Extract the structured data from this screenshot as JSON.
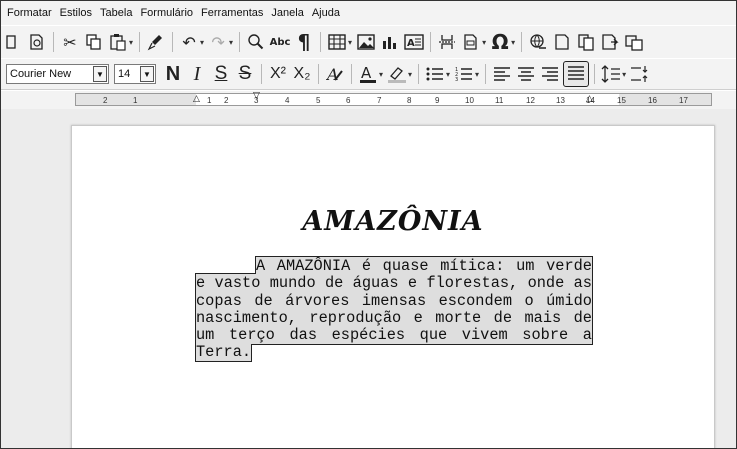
{
  "menu": {
    "items": [
      "Formatar",
      "Estilos",
      "Tabela",
      "Formulário",
      "Ferramentas",
      "Janela",
      "Ajuda"
    ]
  },
  "toolbar2": {
    "font_name": "Courier New",
    "font_size": "14",
    "bold_label": "N",
    "italic_label": "I",
    "underline_label": "S",
    "strike_label": "S",
    "superscript_label": "X²",
    "subscript_label": "X₂"
  },
  "toolbar1": {
    "spelling_label": "Abc",
    "pilcrow_label": "¶",
    "omega_label": "Ω"
  },
  "ruler": {
    "ticks": [
      "2",
      "1",
      "1",
      "2",
      "3",
      "4",
      "5",
      "6",
      "7",
      "8",
      "9",
      "10",
      "11",
      "12",
      "13",
      "14",
      "15",
      "16",
      "17"
    ]
  },
  "document": {
    "title": "AMAZÔNIA",
    "body": "A AMAZÔNIA é quase mítica: um verde e vasto mundo de águas e florestas, onde as copas de árvores imensas escondem o úmido nascimento, reprodução e morte de mais de um terço das espécies que vivem sobre a Terra."
  },
  "colors": {
    "toolbar_bg": "#f3f3f3",
    "selection_bg": "#dedede",
    "workspace_bg": "#ececec"
  }
}
